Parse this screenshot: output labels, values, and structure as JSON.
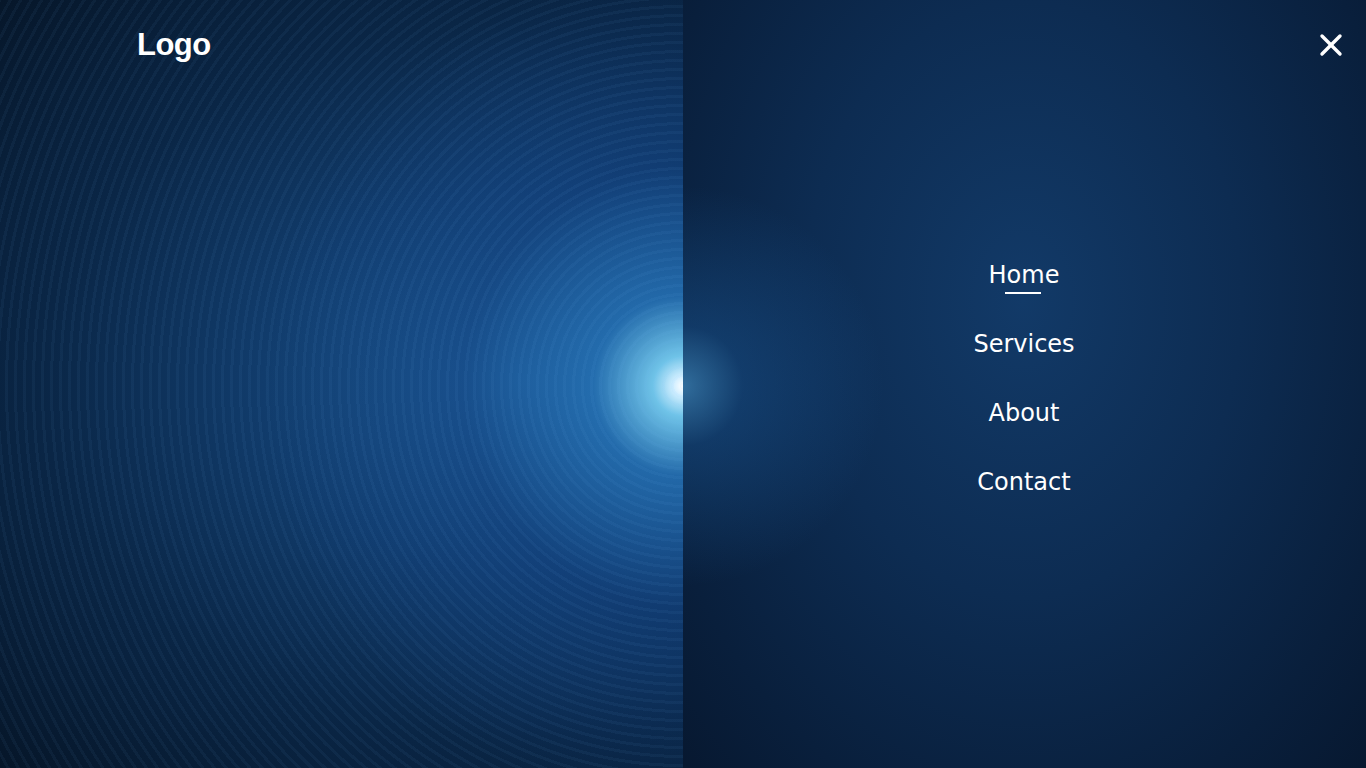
{
  "logo": "Logo",
  "nav": {
    "items": [
      {
        "label": "Home",
        "selected": true
      },
      {
        "label": "Services",
        "selected": false
      },
      {
        "label": "About",
        "selected": false
      },
      {
        "label": "Contact",
        "selected": false
      }
    ]
  }
}
